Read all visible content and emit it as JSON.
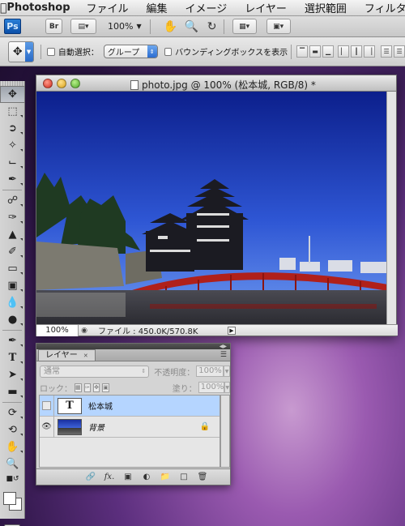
{
  "menubar": {
    "app_name": "Photoshop",
    "items": [
      "ファイル",
      "編集",
      "イメージ",
      "レイヤー",
      "選択範囲",
      "フィルタ"
    ]
  },
  "appbar": {
    "ps_label": "Ps",
    "bridge_label": "Br",
    "zoom": "100%"
  },
  "options": {
    "auto_select_label": "自動選択：",
    "auto_select_value": "グループ",
    "show_bbox_label": "バウンディングボックスを表示"
  },
  "document": {
    "title": "photo.jpg @ 100% (松本城, RGB/8) *",
    "zoom": "100%",
    "file_info": "ファイル : 450.0K/570.8K"
  },
  "layers_panel": {
    "tab_label": "レイヤー",
    "blend_mode": "通常",
    "opacity_label": "不透明度：",
    "opacity_value": "100%",
    "lock_label": "ロック：",
    "fill_label": "塗り：",
    "fill_value": "100%",
    "layers": [
      {
        "name": "松本城",
        "type": "text",
        "thumb_glyph": "T",
        "selected": true,
        "visible": false
      },
      {
        "name": "背景",
        "type": "background",
        "selected": false,
        "visible": true,
        "locked": true
      }
    ]
  },
  "colors": {
    "sky_top": "#0c1f8c",
    "sky_bottom": "#5c8cf0",
    "bridge_red": "#b0201a",
    "selection_blue": "#b5d5ff"
  }
}
